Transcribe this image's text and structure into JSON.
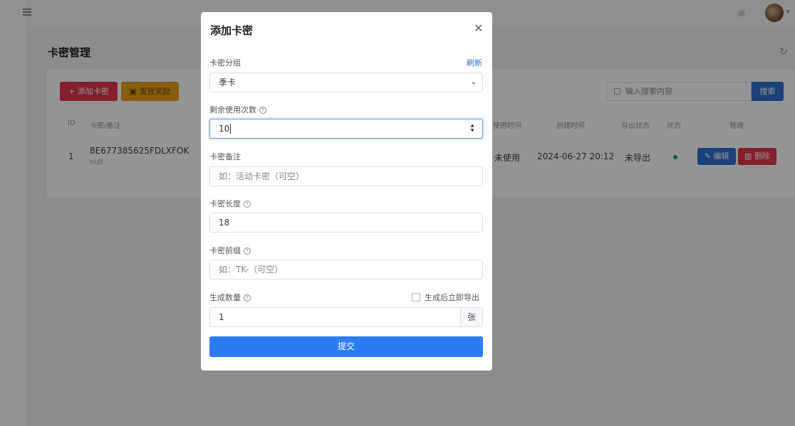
{
  "background": {
    "page_title": "卡密管理",
    "toolbar": {
      "add_label": "+ 添加卡密",
      "gift_label": "发放奖励",
      "search_placeholder": "输入搜索内容",
      "search_label": "搜索"
    },
    "table": {
      "headers": [
        "ID",
        "卡密/备注",
        "使用时间",
        "创建时间",
        "导出状态",
        "状态",
        "管理"
      ],
      "row": {
        "id": "1",
        "card": "8E677385625FDLXFOK",
        "note": "null",
        "use_status": "未使用",
        "created": "2024-06-27 20:12",
        "export_status": "未导出",
        "status_color": "#1fa36c"
      },
      "edit_label": "编辑",
      "delete_label": "删除"
    }
  },
  "modal": {
    "title": "添加卡密",
    "close_icon": "close-icon",
    "group": {
      "label": "卡密分组",
      "refresh_label": "刷新",
      "value": "季卡"
    },
    "uses": {
      "label": "剩余使用次数",
      "value": "10"
    },
    "remark": {
      "label": "卡密备注",
      "placeholder": "如：活动卡密（可空）"
    },
    "length": {
      "label": "卡密长度",
      "value": "18"
    },
    "prefix": {
      "label": "卡密前缀",
      "placeholder": "如：TK-（可空）"
    },
    "quantity": {
      "label": "生成数量",
      "value": "1",
      "suffix": "张",
      "export_checkbox_label": "生成后立即导出",
      "export_checked": false
    },
    "submit_label": "提交",
    "accent_color": "#2d7cf6"
  }
}
